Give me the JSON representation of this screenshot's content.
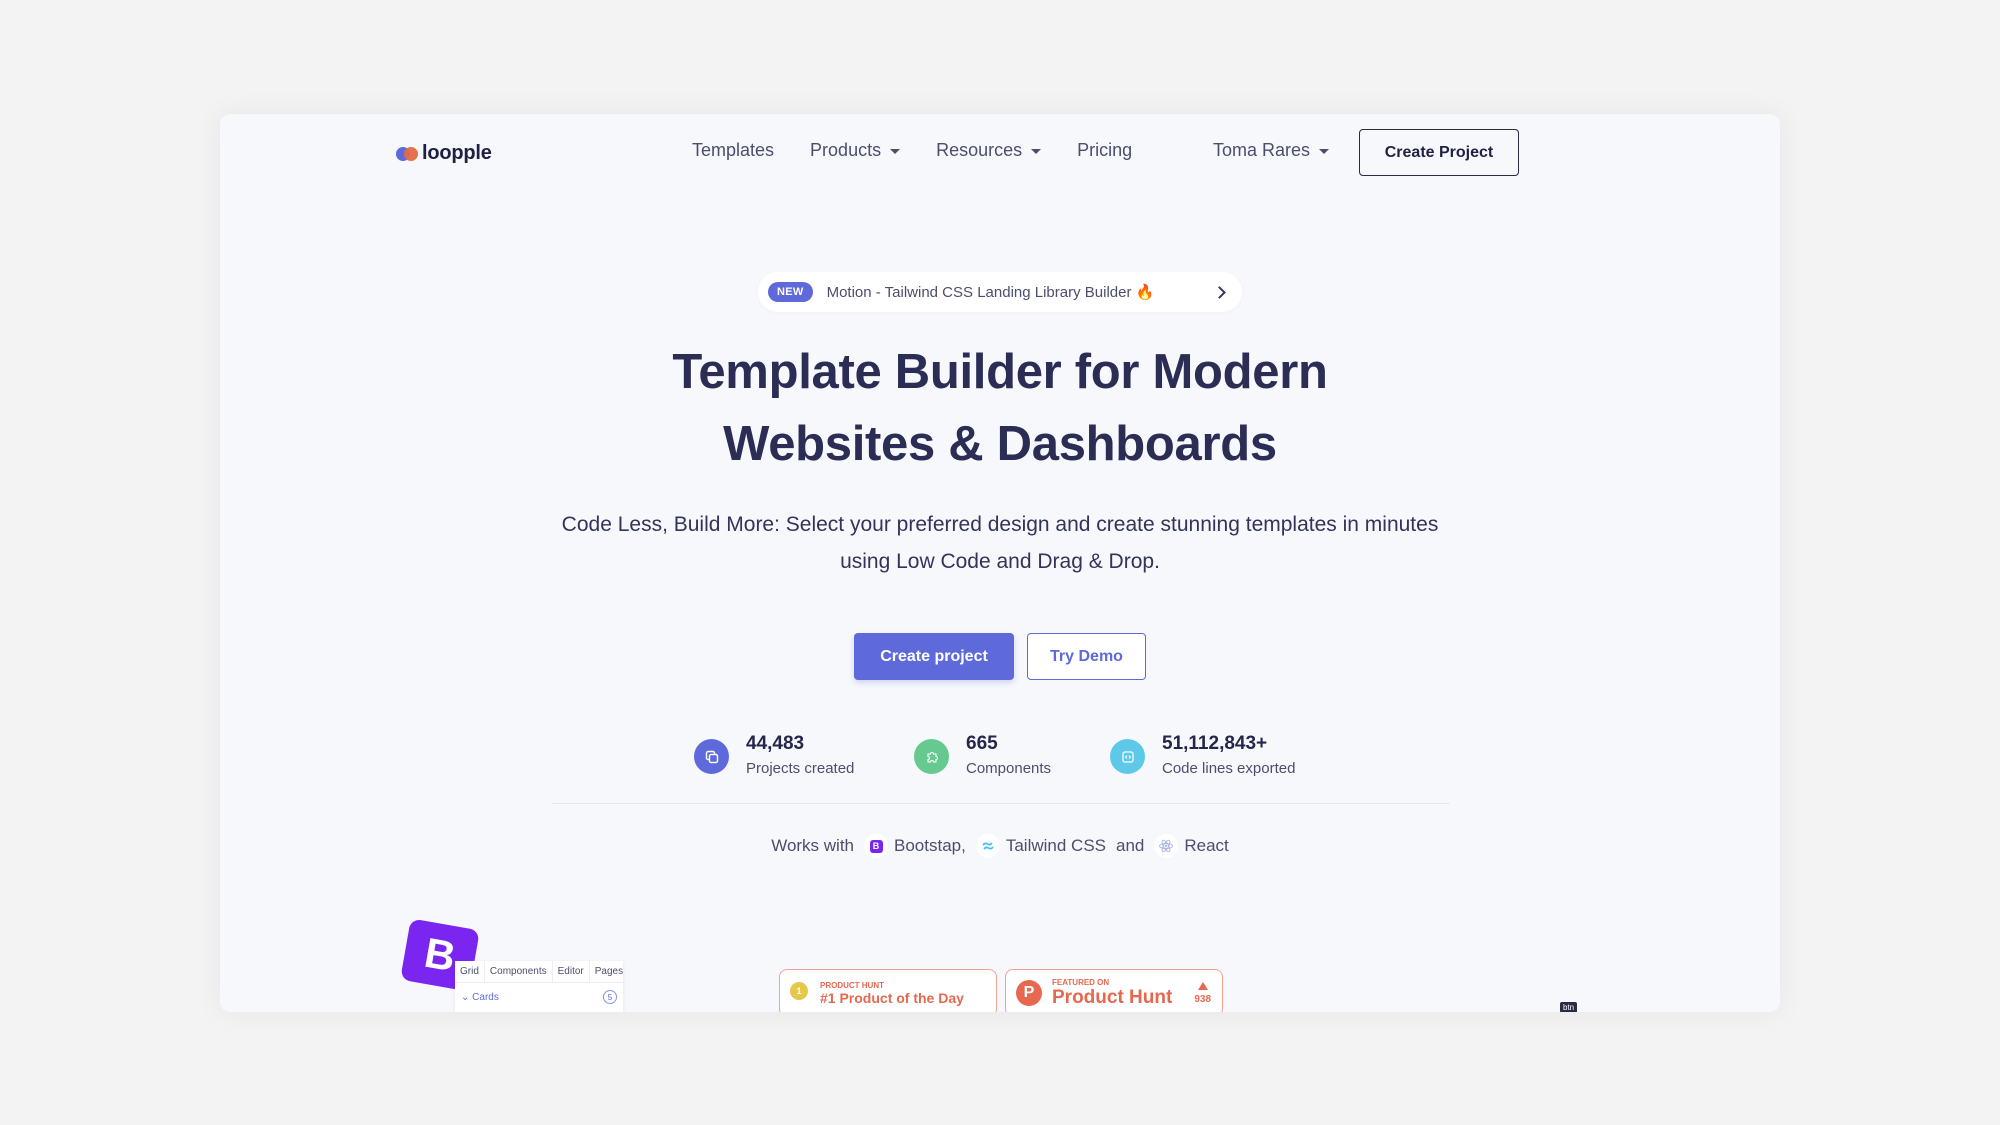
{
  "brand": {
    "name": "loopple",
    "colors": {
      "primary": "#5e6ad9",
      "accent": "#e46a44",
      "dark": "#2b2d55"
    }
  },
  "nav": {
    "links": [
      {
        "label": "Templates",
        "dropdown": false
      },
      {
        "label": "Products",
        "dropdown": true
      },
      {
        "label": "Resources",
        "dropdown": true
      },
      {
        "label": "Pricing",
        "dropdown": false
      }
    ],
    "user": "Toma Rares",
    "cta": "Create Project"
  },
  "announcement": {
    "badge": "NEW",
    "text": "Motion - Tailwind CSS Landing Library Builder 🔥",
    "icon": "chevron-right-icon"
  },
  "hero": {
    "title_line1": "Template Builder for Modern",
    "title_line2": "Websites & Dashboards",
    "subtitle": "Code Less, Build More: Select your preferred design and create stunning templates in minutes using Low Code and Drag & Drop.",
    "primary_button": "Create project",
    "secondary_button": "Try Demo"
  },
  "stats": [
    {
      "value": "44,483",
      "label": "Projects created",
      "icon": "copy-icon",
      "color": "#5e6ad9"
    },
    {
      "value": "665",
      "label": "Components",
      "icon": "puzzle-icon",
      "color": "#66c98f"
    },
    {
      "value": "51,112,843+",
      "label": "Code lines exported",
      "icon": "code-icon",
      "color": "#5ec8e8"
    }
  ],
  "works_with": {
    "prefix": "Works with",
    "bootstrap": "Bootstap,",
    "tailwind": "Tailwind CSS",
    "and": "and",
    "react": "React"
  },
  "preview": {
    "bootstrap_logo": "B",
    "tabs": [
      "Grid",
      "Components",
      "Editor",
      "Pages"
    ],
    "section": "Cards",
    "section_count": "5",
    "tag": "btn"
  },
  "badges": {
    "potd_small": "PRODUCT HUNT",
    "potd_big": "#1 Product of the Day",
    "medal": "1",
    "featured_small": "FEATURED ON",
    "featured_big": "Product Hunt",
    "ph_letter": "P",
    "upvotes": "938"
  }
}
